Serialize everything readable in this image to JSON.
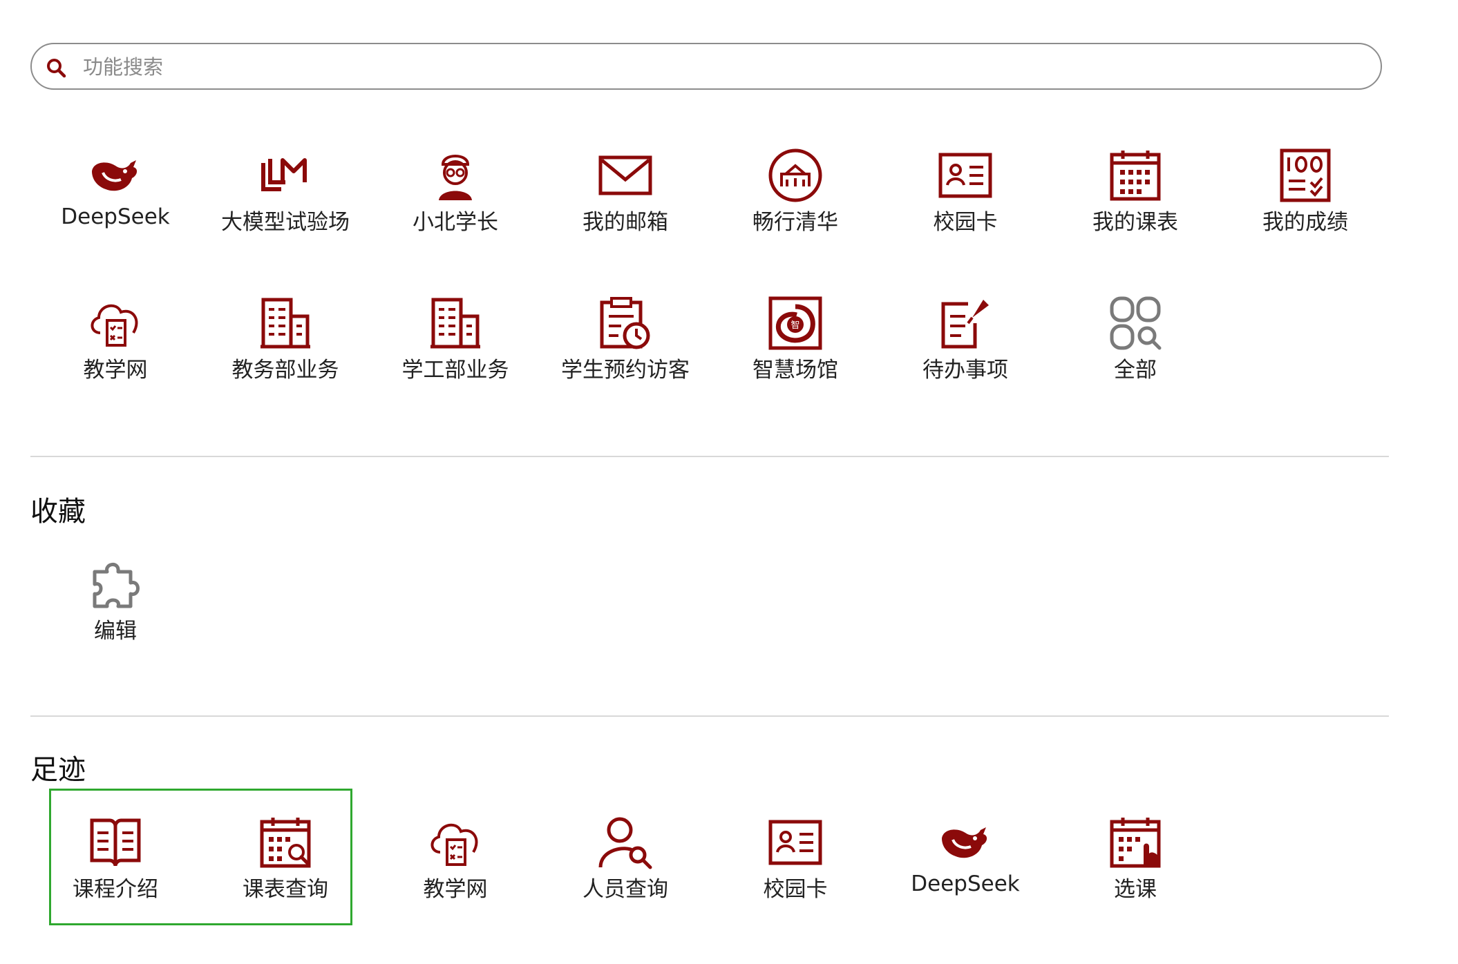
{
  "search": {
    "placeholder": "功能搜索",
    "value": ""
  },
  "colors": {
    "brand": "#8b0a0a",
    "neutral_icon": "#7a7a7a",
    "highlight": "#2fa82f"
  },
  "apps": [
    {
      "label": "DeepSeek",
      "icon": "deepseek-whale-icon"
    },
    {
      "label": "大模型试验场",
      "icon": "llm-logo-icon"
    },
    {
      "label": "小北学长",
      "icon": "student-avatar-icon"
    },
    {
      "label": "我的邮箱",
      "icon": "mail-icon"
    },
    {
      "label": "畅行清华",
      "icon": "campus-gate-icon"
    },
    {
      "label": "校园卡",
      "icon": "id-card-icon"
    },
    {
      "label": "我的课表",
      "icon": "calendar-icon"
    },
    {
      "label": "我的成绩",
      "icon": "grade-100-icon"
    },
    {
      "label": "教学网",
      "icon": "cloud-clipboard-icon"
    },
    {
      "label": "教务部业务",
      "icon": "building-icon"
    },
    {
      "label": "学工部业务",
      "icon": "building-icon"
    },
    {
      "label": "学生预约访客",
      "icon": "clipboard-clock-icon"
    },
    {
      "label": "智慧场馆",
      "icon": "smart-venue-icon"
    },
    {
      "label": "待办事项",
      "icon": "todo-pin-icon"
    },
    {
      "label": "全部",
      "icon": "all-apps-icon"
    }
  ],
  "favorites": {
    "title": "收藏",
    "items": [
      {
        "label": "编辑",
        "icon": "puzzle-icon"
      }
    ]
  },
  "history": {
    "title": "足迹",
    "items": [
      {
        "label": "课程介绍",
        "icon": "open-book-icon"
      },
      {
        "label": "课表查询",
        "icon": "calendar-search-icon"
      },
      {
        "label": "教学网",
        "icon": "cloud-clipboard-icon"
      },
      {
        "label": "人员查询",
        "icon": "person-search-icon"
      },
      {
        "label": "校园卡",
        "icon": "id-card-icon"
      },
      {
        "label": "DeepSeek",
        "icon": "deepseek-whale-icon"
      },
      {
        "label": "选课",
        "icon": "calendar-tap-icon"
      }
    ]
  }
}
